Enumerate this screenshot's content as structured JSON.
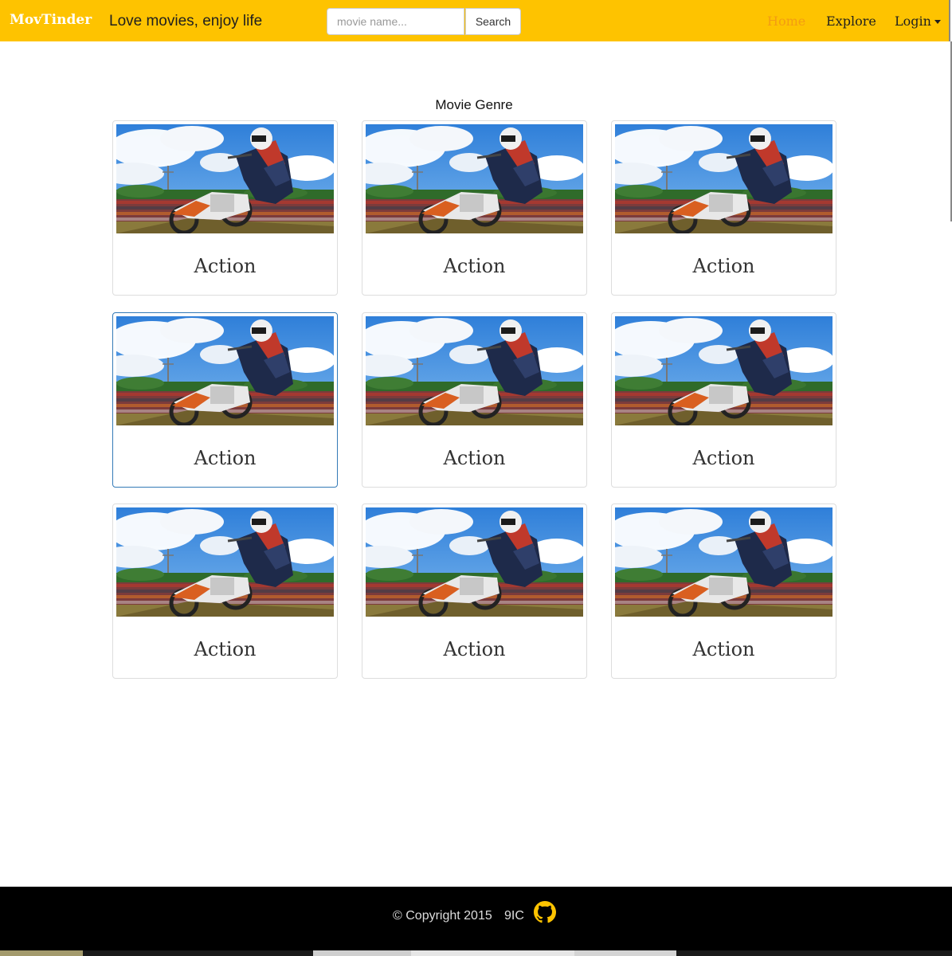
{
  "navbar": {
    "brand": "MovTinder",
    "tagline": "Love movies, enjoy life",
    "search": {
      "placeholder": "movie name...",
      "value": "",
      "button_label": "Search"
    },
    "links": {
      "home": "Home",
      "explore": "Explore",
      "login": "Login"
    }
  },
  "main": {
    "title": "Movie Genre",
    "genres": [
      {
        "label": "Action",
        "active": false
      },
      {
        "label": "Action",
        "active": false
      },
      {
        "label": "Action",
        "active": false
      },
      {
        "label": "Action",
        "active": true
      },
      {
        "label": "Action",
        "active": false
      },
      {
        "label": "Action",
        "active": false
      },
      {
        "label": "Action",
        "active": false
      },
      {
        "label": "Action",
        "active": false
      },
      {
        "label": "Action",
        "active": false
      }
    ]
  },
  "footer": {
    "copyright": "© Copyright 2015",
    "org": "9IC",
    "icon": "github-icon"
  },
  "colors": {
    "navbar_bg": "#fec300",
    "brand": "#ffffff",
    "active_link": "#f39c12",
    "active_card_border": "#337ab7",
    "footer_bg": "#000000"
  }
}
